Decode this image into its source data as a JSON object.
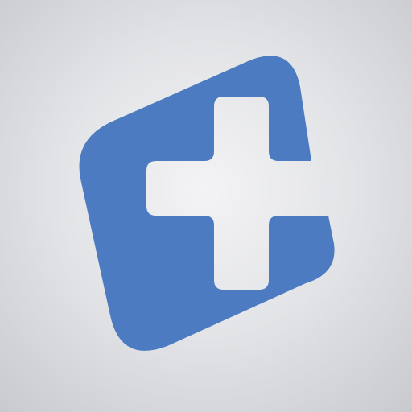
{
  "logo": {
    "icon": "medical-cross-logo-icon",
    "brand_color": "#4c7bc1",
    "cross_color": "#e9eaed"
  }
}
